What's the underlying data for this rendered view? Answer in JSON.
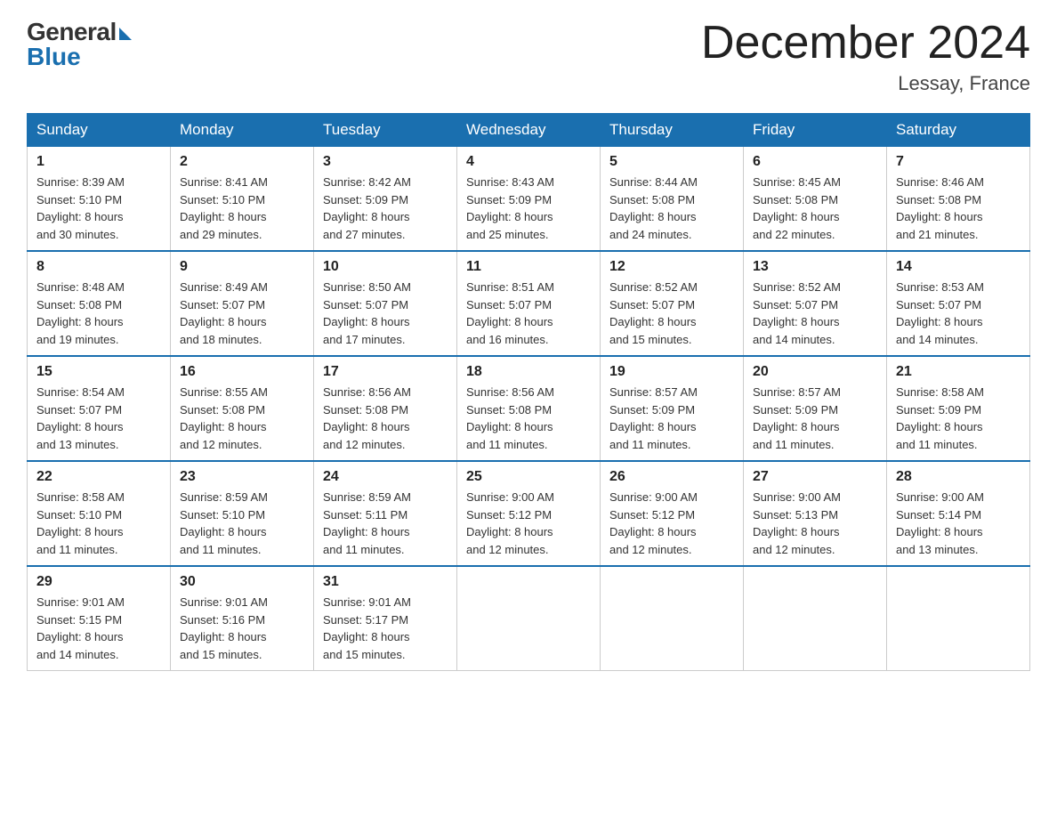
{
  "header": {
    "logo_general": "General",
    "logo_blue": "Blue",
    "title": "December 2024",
    "location": "Lessay, France"
  },
  "weekdays": [
    "Sunday",
    "Monday",
    "Tuesday",
    "Wednesday",
    "Thursday",
    "Friday",
    "Saturday"
  ],
  "weeks": [
    [
      {
        "day": "1",
        "sunrise": "8:39 AM",
        "sunset": "5:10 PM",
        "daylight": "8 hours and 30 minutes."
      },
      {
        "day": "2",
        "sunrise": "8:41 AM",
        "sunset": "5:10 PM",
        "daylight": "8 hours and 29 minutes."
      },
      {
        "day": "3",
        "sunrise": "8:42 AM",
        "sunset": "5:09 PM",
        "daylight": "8 hours and 27 minutes."
      },
      {
        "day": "4",
        "sunrise": "8:43 AM",
        "sunset": "5:09 PM",
        "daylight": "8 hours and 25 minutes."
      },
      {
        "day": "5",
        "sunrise": "8:44 AM",
        "sunset": "5:08 PM",
        "daylight": "8 hours and 24 minutes."
      },
      {
        "day": "6",
        "sunrise": "8:45 AM",
        "sunset": "5:08 PM",
        "daylight": "8 hours and 22 minutes."
      },
      {
        "day": "7",
        "sunrise": "8:46 AM",
        "sunset": "5:08 PM",
        "daylight": "8 hours and 21 minutes."
      }
    ],
    [
      {
        "day": "8",
        "sunrise": "8:48 AM",
        "sunset": "5:08 PM",
        "daylight": "8 hours and 19 minutes."
      },
      {
        "day": "9",
        "sunrise": "8:49 AM",
        "sunset": "5:07 PM",
        "daylight": "8 hours and 18 minutes."
      },
      {
        "day": "10",
        "sunrise": "8:50 AM",
        "sunset": "5:07 PM",
        "daylight": "8 hours and 17 minutes."
      },
      {
        "day": "11",
        "sunrise": "8:51 AM",
        "sunset": "5:07 PM",
        "daylight": "8 hours and 16 minutes."
      },
      {
        "day": "12",
        "sunrise": "8:52 AM",
        "sunset": "5:07 PM",
        "daylight": "8 hours and 15 minutes."
      },
      {
        "day": "13",
        "sunrise": "8:52 AM",
        "sunset": "5:07 PM",
        "daylight": "8 hours and 14 minutes."
      },
      {
        "day": "14",
        "sunrise": "8:53 AM",
        "sunset": "5:07 PM",
        "daylight": "8 hours and 14 minutes."
      }
    ],
    [
      {
        "day": "15",
        "sunrise": "8:54 AM",
        "sunset": "5:07 PM",
        "daylight": "8 hours and 13 minutes."
      },
      {
        "day": "16",
        "sunrise": "8:55 AM",
        "sunset": "5:08 PM",
        "daylight": "8 hours and 12 minutes."
      },
      {
        "day": "17",
        "sunrise": "8:56 AM",
        "sunset": "5:08 PM",
        "daylight": "8 hours and 12 minutes."
      },
      {
        "day": "18",
        "sunrise": "8:56 AM",
        "sunset": "5:08 PM",
        "daylight": "8 hours and 11 minutes."
      },
      {
        "day": "19",
        "sunrise": "8:57 AM",
        "sunset": "5:09 PM",
        "daylight": "8 hours and 11 minutes."
      },
      {
        "day": "20",
        "sunrise": "8:57 AM",
        "sunset": "5:09 PM",
        "daylight": "8 hours and 11 minutes."
      },
      {
        "day": "21",
        "sunrise": "8:58 AM",
        "sunset": "5:09 PM",
        "daylight": "8 hours and 11 minutes."
      }
    ],
    [
      {
        "day": "22",
        "sunrise": "8:58 AM",
        "sunset": "5:10 PM",
        "daylight": "8 hours and 11 minutes."
      },
      {
        "day": "23",
        "sunrise": "8:59 AM",
        "sunset": "5:10 PM",
        "daylight": "8 hours and 11 minutes."
      },
      {
        "day": "24",
        "sunrise": "8:59 AM",
        "sunset": "5:11 PM",
        "daylight": "8 hours and 11 minutes."
      },
      {
        "day": "25",
        "sunrise": "9:00 AM",
        "sunset": "5:12 PM",
        "daylight": "8 hours and 12 minutes."
      },
      {
        "day": "26",
        "sunrise": "9:00 AM",
        "sunset": "5:12 PM",
        "daylight": "8 hours and 12 minutes."
      },
      {
        "day": "27",
        "sunrise": "9:00 AM",
        "sunset": "5:13 PM",
        "daylight": "8 hours and 12 minutes."
      },
      {
        "day": "28",
        "sunrise": "9:00 AM",
        "sunset": "5:14 PM",
        "daylight": "8 hours and 13 minutes."
      }
    ],
    [
      {
        "day": "29",
        "sunrise": "9:01 AM",
        "sunset": "5:15 PM",
        "daylight": "8 hours and 14 minutes."
      },
      {
        "day": "30",
        "sunrise": "9:01 AM",
        "sunset": "5:16 PM",
        "daylight": "8 hours and 15 minutes."
      },
      {
        "day": "31",
        "sunrise": "9:01 AM",
        "sunset": "5:17 PM",
        "daylight": "8 hours and 15 minutes."
      },
      null,
      null,
      null,
      null
    ]
  ]
}
